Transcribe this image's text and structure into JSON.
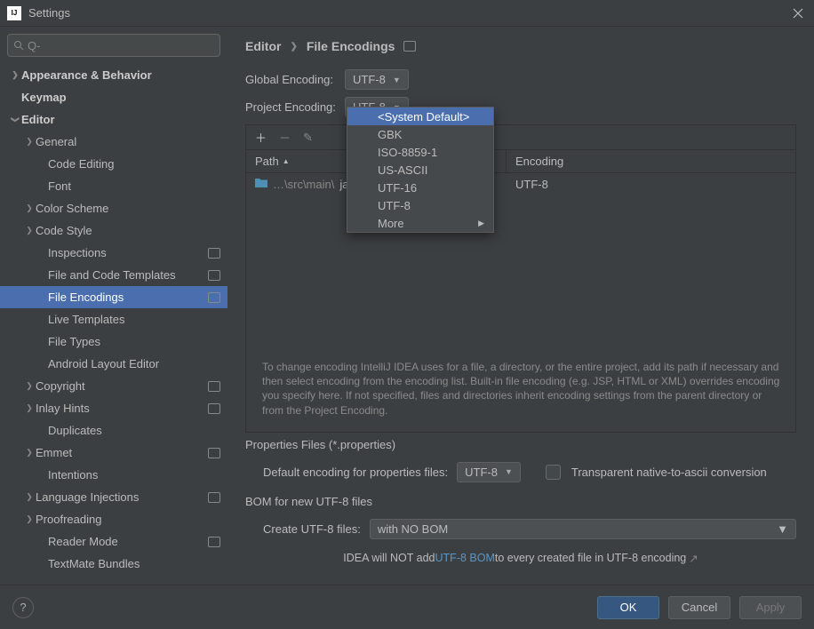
{
  "window": {
    "title": "Settings"
  },
  "search": {
    "placeholder": "Q-"
  },
  "nav": {
    "appearance": "Appearance & Behavior",
    "keymap": "Keymap",
    "editor": "Editor",
    "general": "General",
    "codeEditing": "Code Editing",
    "font": "Font",
    "colorScheme": "Color Scheme",
    "codeStyle": "Code Style",
    "inspections": "Inspections",
    "fileCodeTemplates": "File and Code Templates",
    "fileEncodings": "File Encodings",
    "liveTemplates": "Live Templates",
    "fileTypes": "File Types",
    "androidLayout": "Android Layout Editor",
    "copyright": "Copyright",
    "inlayHints": "Inlay Hints",
    "duplicates": "Duplicates",
    "emmet": "Emmet",
    "intentions": "Intentions",
    "languageInjections": "Language Injections",
    "proofreading": "Proofreading",
    "readerMode": "Reader Mode",
    "textmate": "TextMate Bundles"
  },
  "breadcrumb": {
    "a": "Editor",
    "b": "File Encodings"
  },
  "encoding": {
    "globalLabel": "Global Encoding:",
    "globalValue": "UTF-8",
    "projectLabel": "Project Encoding:",
    "projectValue": "UTF-8"
  },
  "dropdown": {
    "options": [
      "<System Default>",
      "GBK",
      "ISO-8859-1",
      "US-ASCII",
      "UTF-16",
      "UTF-8"
    ],
    "more": "More"
  },
  "table": {
    "col1": "Path",
    "col2": "Encoding",
    "rows": [
      {
        "pathPrefix": "…\\src\\main\\",
        "pathName": "java",
        "enc": "UTF-8"
      }
    ]
  },
  "hint": "To change encoding IntelliJ IDEA uses for a file, a directory, or the entire project, add its path if necessary and then select encoding from the encoding list. Built-in file encoding (e.g. JSP, HTML or XML) overrides encoding you specify here. If not specified, files and directories inherit encoding settings from the parent directory or from the Project Encoding.",
  "props": {
    "title": "Properties Files (*.properties)",
    "defaultLabel": "Default encoding for properties files:",
    "defaultValue": "UTF-8",
    "transparent": "Transparent native-to-ascii conversion"
  },
  "bom": {
    "title": "BOM for new UTF-8 files",
    "createLabel": "Create UTF-8 files:",
    "createValue": "with NO BOM",
    "hint1": "IDEA will NOT add ",
    "hintLink": "UTF-8 BOM",
    "hint2": " to every created file in UTF-8 encoding"
  },
  "buttons": {
    "ok": "OK",
    "cancel": "Cancel",
    "apply": "Apply"
  }
}
